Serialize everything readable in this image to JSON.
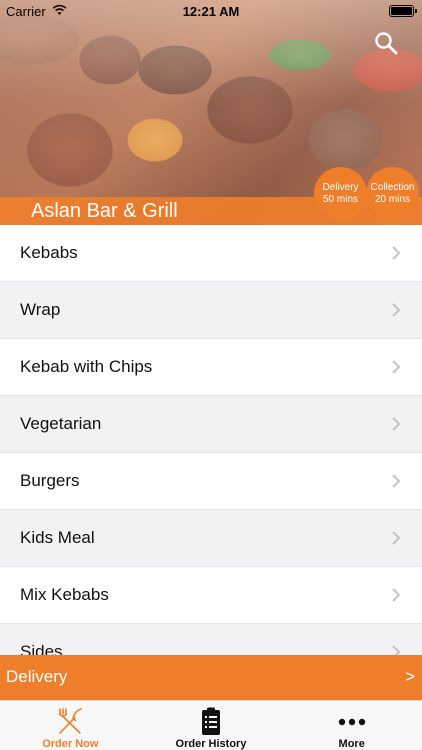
{
  "status_bar": {
    "carrier": "Carrier",
    "time": "12:21 AM"
  },
  "header": {
    "restaurant_name": "Aslan Bar & Grill",
    "delivery_badge": {
      "label": "Delivery",
      "time": "50 mins"
    },
    "collection_badge": {
      "label": "Collection",
      "time": "20 mins"
    }
  },
  "menu": {
    "items": [
      {
        "label": "Kebabs"
      },
      {
        "label": "Wrap"
      },
      {
        "label": "Kebab with Chips"
      },
      {
        "label": "Vegetarian"
      },
      {
        "label": "Burgers"
      },
      {
        "label": "Kids Meal"
      },
      {
        "label": "Mix Kebabs"
      },
      {
        "label": "Sides"
      }
    ]
  },
  "delivery_bar": {
    "label": "Delivery",
    "arrow": ">"
  },
  "tabs": [
    {
      "label": "Order Now",
      "icon": "fork-knife-icon",
      "active": true
    },
    {
      "label": "Order History",
      "icon": "receipt-icon",
      "active": false
    },
    {
      "label": "More",
      "icon": "more-dots-icon",
      "active": false
    }
  ],
  "colors": {
    "accent": "#ef7e2b",
    "text": "#111111",
    "row_alt": "#f2f2f5"
  }
}
